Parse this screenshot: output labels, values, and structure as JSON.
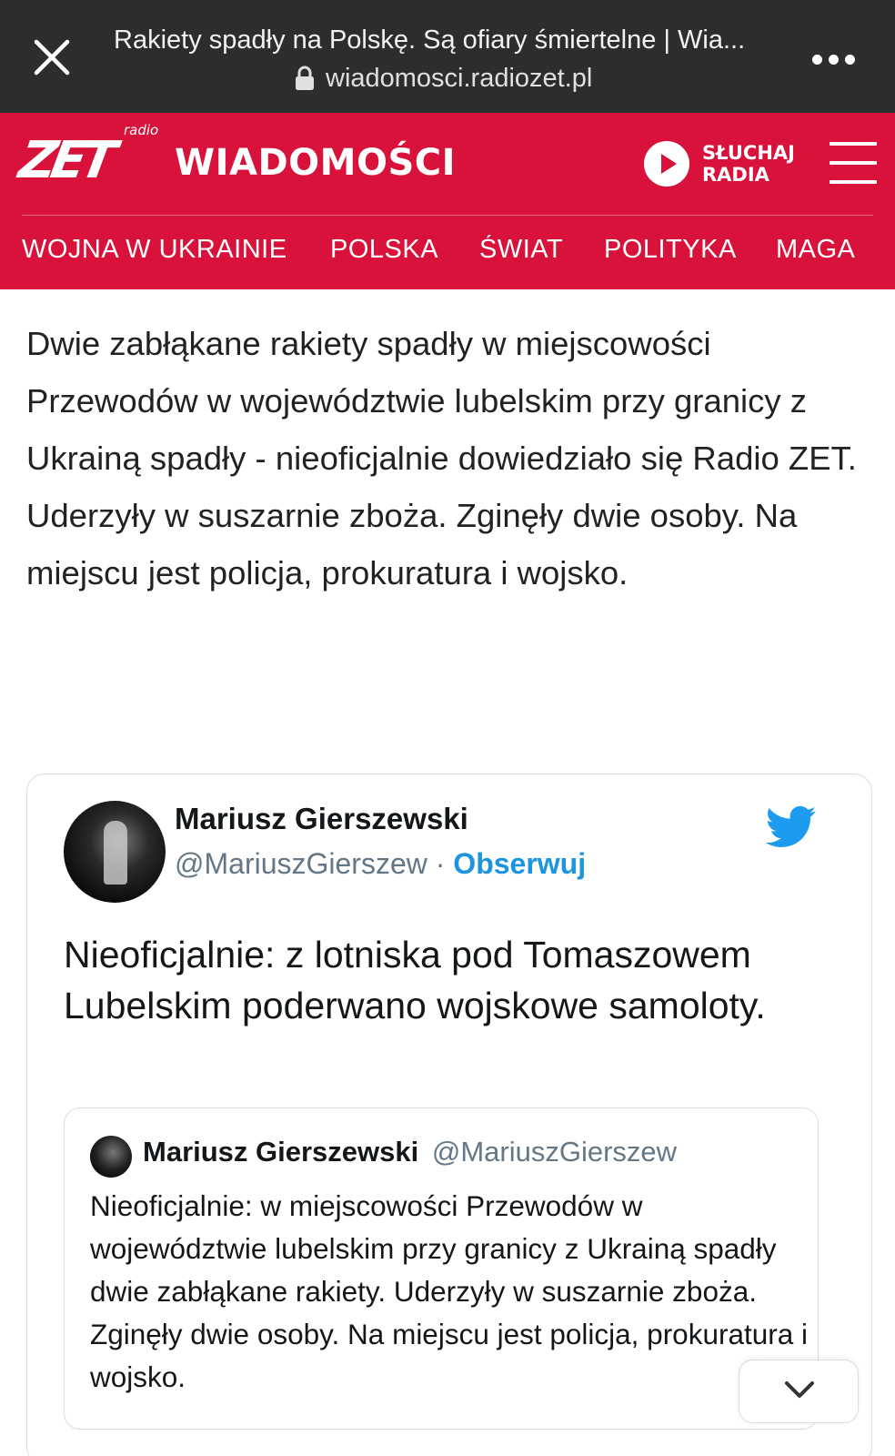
{
  "browser": {
    "tab_title": "Rakiety spadły na Polskę. Są ofiary śmiertelne | Wia...",
    "url": "wiadomosci.radiozet.pl",
    "close_icon": "close-icon",
    "lock_icon": "lock-icon",
    "menu_icon": "more-dots-icon"
  },
  "header": {
    "logo_small": "radio",
    "logo_text": "ZET",
    "section_title": "WIADOMOŚCI",
    "listen_label": "SŁUCHAJ RADIA",
    "listen_line1": "SŁUCHAJ",
    "listen_line2": "RADIA",
    "brand_color": "#d8123a"
  },
  "nav": {
    "items": [
      {
        "label": "WOJNA W UKRAINIE"
      },
      {
        "label": "POLSKA"
      },
      {
        "label": "ŚWIAT"
      },
      {
        "label": "POLITYKA"
      },
      {
        "label": "MAGA"
      }
    ]
  },
  "article": {
    "lead": "Dwie zabłąkane rakiety spadły w miejscowości Przewodów w województwie lubelskim przy granicy z Ukrainą spadły - nieoficjalnie dowiedziało się Radio ZET. Uderzyły w suszarnie zboża. Zginęły dwie osoby. Na miejscu jest policja, prokuratura i wojsko."
  },
  "tweet": {
    "author_name": "Mariusz Gierszewski",
    "author_handle": "@MariuszGierszew",
    "separator": "·",
    "follow_label": "Obserwuj",
    "text": "Nieoficjalnie: z lotniska pod Tomaszowem Lubelskim poderwano wojskowe samoloty.",
    "accent_color": "#1b95e0",
    "quoted": {
      "author_name": "Mariusz Gierszewski",
      "author_handle": "@MariuszGierszew",
      "text": "Nieoficjalnie: w miejscowości Przewodów  w województwie lubelskim przy granicy z Ukrainą spadły dwie zabłąkane rakiety. Uderzyły w suszarnie zboża. Zginęły dwie osoby. Na miejscu jest policja, prokuratura i wojsko."
    }
  }
}
